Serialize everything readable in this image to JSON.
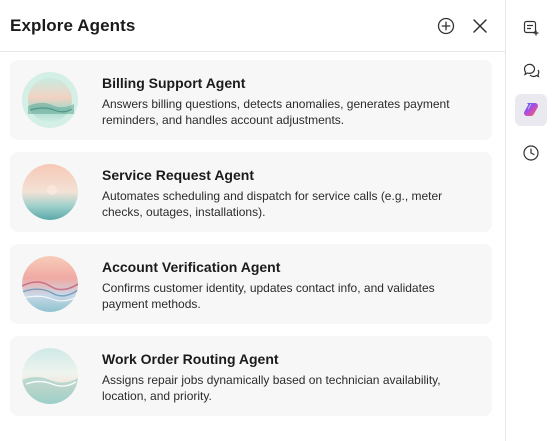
{
  "header": {
    "title": "Explore Agents",
    "add_icon": "plus-circle-icon",
    "close_icon": "close-icon"
  },
  "agents": [
    {
      "name": "Billing Support Agent",
      "description": "Answers billing questions, detects anomalies, generates payment reminders, and handles account adjustments."
    },
    {
      "name": "Service Request Agent",
      "description": "Automates scheduling and dispatch for service calls (e.g., meter checks, outages, installations)."
    },
    {
      "name": "Account Verification Agent",
      "description": "Confirms customer identity, updates contact info, and validates payment methods."
    },
    {
      "name": "Work Order Routing Agent",
      "description": "Assigns repair jobs dynamically based on technician availability, location, and priority."
    }
  ],
  "rail": {
    "items": [
      {
        "icon": "new-chat-icon",
        "active": false
      },
      {
        "icon": "chat-bubbles-icon",
        "active": false
      },
      {
        "icon": "copilot-logo-icon",
        "active": true
      },
      {
        "icon": "history-clock-icon",
        "active": false
      }
    ]
  },
  "colors": {
    "card_background": "#f7f7f7",
    "active_rail_background": "#e9e9ef",
    "divider": "#e6e6e6"
  }
}
